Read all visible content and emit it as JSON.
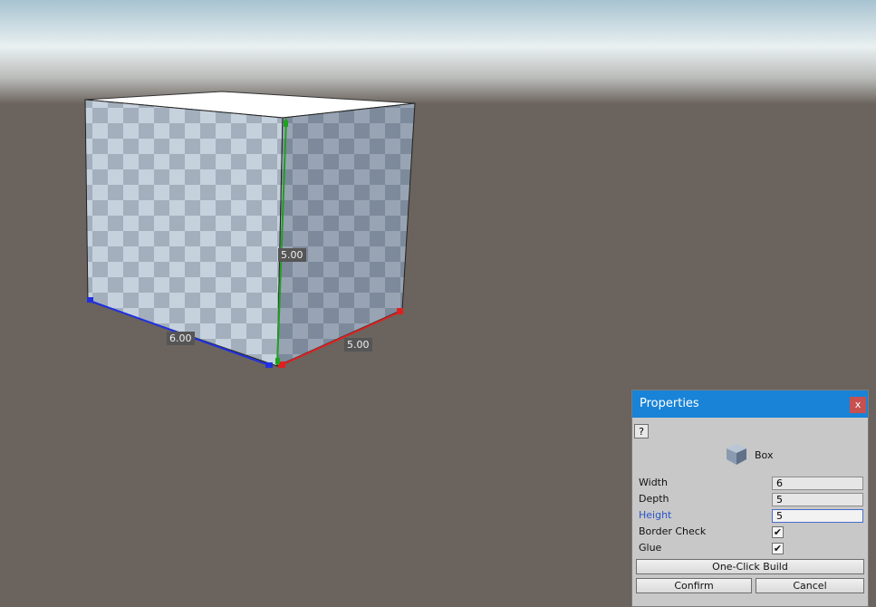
{
  "viewport": {
    "dimensions": {
      "width": "6.00",
      "height": "5.00",
      "depth": "5.00"
    }
  },
  "panel": {
    "title": "Properties",
    "close_glyph": "x",
    "help_glyph": "?",
    "object_icon": "cube-icon",
    "object_name": "Box",
    "properties": [
      {
        "label": "Width",
        "value": "6"
      },
      {
        "label": "Depth",
        "value": "5"
      },
      {
        "label": "Height",
        "value": "5"
      }
    ],
    "options": [
      {
        "label": "Border Check",
        "checked": true
      },
      {
        "label": "Glue",
        "checked": true
      }
    ],
    "check_glyph": "✔",
    "buttons": {
      "build": "One-Click Build",
      "confirm": "Confirm",
      "cancel": "Cancel"
    }
  },
  "colors": {
    "titlebar": "#1883d7",
    "close_button": "#c75050",
    "active_label": "#2a55c8",
    "x_axis": "#e02020",
    "y_axis": "#20a020",
    "z_axis": "#2030e0"
  }
}
